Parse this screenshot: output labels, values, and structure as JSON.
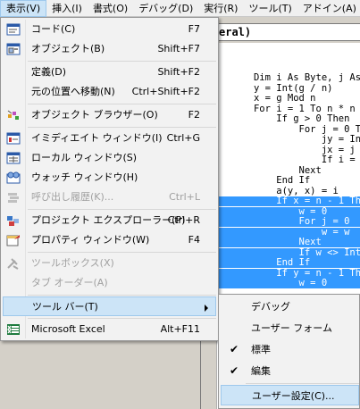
{
  "menubar": {
    "items": [
      {
        "label": "表示(V)",
        "active": true
      },
      {
        "label": "挿入(I)"
      },
      {
        "label": "書式(O)"
      },
      {
        "label": "デバッグ(D)"
      },
      {
        "label": "実行(R)"
      },
      {
        "label": "ツール(T)"
      },
      {
        "label": "アドイン(A)"
      }
    ]
  },
  "code_window": {
    "title": "eral)",
    "lines": [
      {
        "text": "   Dim i As Byte, j As",
        "selected": false
      },
      {
        "text": "   y = Int(g / n)",
        "selected": false
      },
      {
        "text": "   x = g Mod n",
        "selected": false
      },
      {
        "text": "   For i = 1 To n * n",
        "selected": false
      },
      {
        "text": "       If g > 0 Then",
        "selected": false
      },
      {
        "text": "           For j = 0 To",
        "selected": false
      },
      {
        "text": "               jy = Int",
        "selected": false
      },
      {
        "text": "               jx = j M",
        "selected": false
      },
      {
        "text": "               If i = a",
        "selected": false
      },
      {
        "text": "           Next",
        "selected": false
      },
      {
        "text": "       End If",
        "selected": false
      },
      {
        "text": "       a(y, x) = i",
        "selected": false
      },
      {
        "text": "       If x = n - 1 Th",
        "selected": true
      },
      {
        "text": "           w = 0",
        "selected": true
      },
      {
        "text": "           For j = 0",
        "selected": true
      },
      {
        "text": "               w = w",
        "selected": true
      },
      {
        "text": "           Next",
        "selected": true
      },
      {
        "text": "           If w <> Int",
        "selected": true
      },
      {
        "text": "       End If",
        "selected": true
      },
      {
        "text": "       If y = n - 1 Th",
        "selected": true
      },
      {
        "text": "           w = 0",
        "selected": true
      }
    ]
  },
  "view_menu": {
    "items": [
      {
        "name": "menu-code",
        "icon": "code-window-icon",
        "label": "コード(C)",
        "shortcut": "F7",
        "enabled": true
      },
      {
        "name": "menu-object",
        "icon": "object-window-icon",
        "label": "オブジェクト(B)",
        "shortcut": "Shift+F7",
        "enabled": true
      },
      {
        "name": "menu-definition",
        "icon": "",
        "label": "定義(D)",
        "shortcut": "Shift+F2",
        "enabled": true
      },
      {
        "name": "menu-last-position",
        "icon": "",
        "label": "元の位置へ移動(N)",
        "shortcut": "Ctrl+Shift+F2",
        "enabled": true
      },
      {
        "name": "menu-object-browser",
        "icon": "object-browser-icon",
        "label": "オブジェクト ブラウザー(O)",
        "shortcut": "F2",
        "enabled": true
      },
      {
        "name": "menu-immediate",
        "icon": "immediate-window-icon",
        "label": "イミディエイト ウィンドウ(I)",
        "shortcut": "Ctrl+G",
        "enabled": true
      },
      {
        "name": "menu-locals",
        "icon": "locals-window-icon",
        "label": "ローカル ウィンドウ(S)",
        "shortcut": "",
        "enabled": true
      },
      {
        "name": "menu-watch",
        "icon": "watch-window-icon",
        "label": "ウォッチ ウィンドウ(H)",
        "shortcut": "",
        "enabled": true
      },
      {
        "name": "menu-call-stack",
        "icon": "call-stack-icon",
        "label": "呼び出し履歴(K)...",
        "shortcut": "Ctrl+L",
        "enabled": false
      },
      {
        "name": "menu-project-explorer",
        "icon": "project-explorer-icon",
        "label": "プロジェクト エクスプローラー(P)",
        "shortcut": "Ctrl+R",
        "enabled": true
      },
      {
        "name": "menu-properties",
        "icon": "properties-window-icon",
        "label": "プロパティ ウィンドウ(W)",
        "shortcut": "F4",
        "enabled": true
      },
      {
        "name": "menu-toolbox",
        "icon": "toolbox-icon",
        "label": "ツールボックス(X)",
        "shortcut": "",
        "enabled": false
      },
      {
        "name": "menu-tab-order",
        "icon": "",
        "label": "タブ オーダー(A)",
        "shortcut": "",
        "enabled": false
      },
      {
        "name": "menu-toolbars",
        "icon": "",
        "label": "ツール バー(T)",
        "shortcut": "",
        "enabled": true,
        "highlighted": true,
        "submenu": true
      },
      {
        "name": "menu-microsoft-excel",
        "icon": "excel-icon",
        "label": "Microsoft Excel",
        "shortcut": "Alt+F11",
        "enabled": true
      }
    ]
  },
  "toolbar_submenu": {
    "items": [
      {
        "label": "デバッグ",
        "checked": false
      },
      {
        "label": "ユーザー フォーム",
        "checked": false
      },
      {
        "label": "標準",
        "checked": true
      },
      {
        "label": "編集",
        "checked": true
      },
      {
        "label": "ユーザー設定(C)...",
        "checked": false,
        "highlighted": true
      }
    ],
    "check_glyph": "✔"
  },
  "colors": {
    "selection": "#3399ff",
    "menu_highlight": "#cce4f7",
    "menu_highlight_border": "#9ec8ec",
    "disabled_text": "#a0a0a0"
  }
}
